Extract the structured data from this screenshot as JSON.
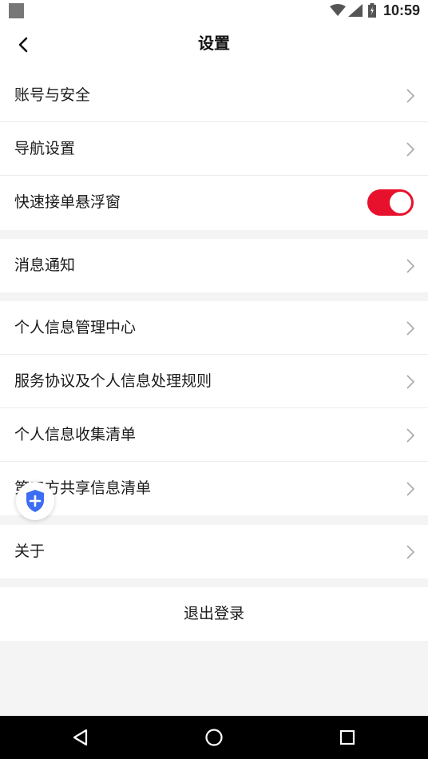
{
  "status_bar": {
    "time": "10:59"
  },
  "header": {
    "title": "设置"
  },
  "groups": {
    "account": {
      "items": [
        {
          "label": "账号与安全"
        },
        {
          "label": "导航设置"
        },
        {
          "label": "快速接单悬浮窗",
          "toggle": true
        }
      ]
    },
    "notify": {
      "items": [
        {
          "label": "消息通知"
        }
      ]
    },
    "privacy": {
      "items": [
        {
          "label": "个人信息管理中心"
        },
        {
          "label": "服务协议及个人信息处理规则"
        },
        {
          "label": "个人信息收集清单"
        },
        {
          "label": "第三方共享信息清单"
        }
      ]
    },
    "about": {
      "items": [
        {
          "label": "关于"
        }
      ]
    }
  },
  "logout": {
    "label": "退出登录"
  },
  "colors": {
    "toggle_on": "#e8112d",
    "shield": "#3d6df2",
    "background": "#f4f4f4"
  }
}
